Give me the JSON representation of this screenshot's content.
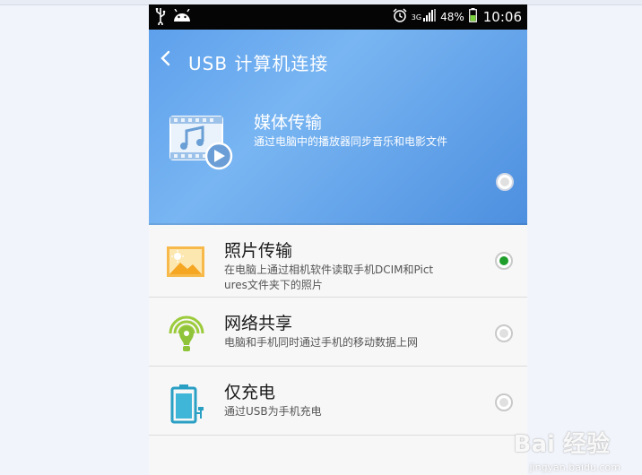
{
  "status_bar": {
    "network": "3G",
    "battery": "48%",
    "time": "10:06",
    "icons": [
      "usb-icon",
      "android-icon",
      "alarm-icon",
      "signal-icon",
      "battery-icon"
    ]
  },
  "header": {
    "title": "USB 计算机连接"
  },
  "options": [
    {
      "title": "媒体传输",
      "desc": "通过电脑中的播放器同步音乐和电影文件",
      "selected": false,
      "icon": "media-transfer-icon"
    },
    {
      "title": "照片传输",
      "desc": "在电脑上通过相机软件读取手机DCIM和Pictures文件夹下的照片",
      "selected": true,
      "icon": "photo-transfer-icon"
    },
    {
      "title": "网络共享",
      "desc": "电脑和手机同时通过手机的移动数据上网",
      "selected": false,
      "icon": "network-share-icon"
    },
    {
      "title": "仅充电",
      "desc": "通过USB为手机充电",
      "selected": false,
      "icon": "charge-only-icon"
    }
  ],
  "watermark": {
    "logo": "Bai 经验",
    "url": "jingyan.baidu.com"
  },
  "colors": {
    "header_blue": "#5ea0ec",
    "selected_green": "#1f9e2c"
  }
}
